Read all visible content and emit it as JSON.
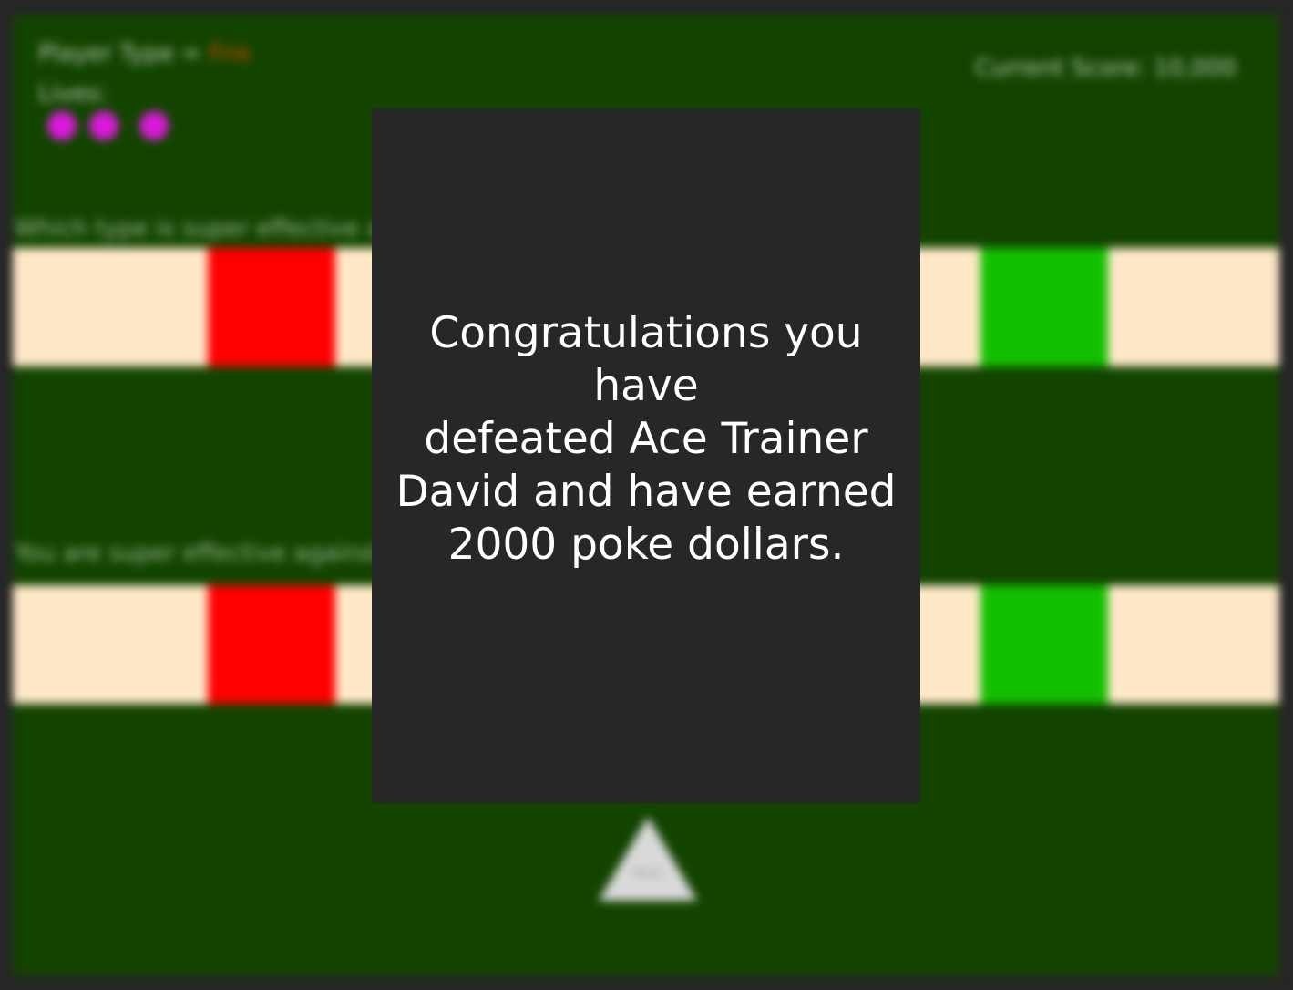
{
  "hud": {
    "player_type_label": "Player Type = ",
    "player_type_value": "Fire",
    "lives_label": "Lives:",
    "lives_count": 3,
    "score_text": "Current Score: 10,000"
  },
  "questions": [
    {
      "prompt": "Which type is super effective against...",
      "answers": [
        "",
        "",
        "",
        ""
      ]
    },
    {
      "prompt": "You are super effective against wh...",
      "answers": [
        "",
        "",
        "",
        ""
      ]
    }
  ],
  "next_button": {
    "label": "Next"
  },
  "modal": {
    "message": "Congratulations you have\ndefeated Ace Trainer \nDavid and have earned\n2000 poke dollars."
  },
  "colors": {
    "board": "#124400",
    "answer_bg": "#ffe8c8",
    "wrong": "#ff0000",
    "correct": "#13c000",
    "modal_bg": "#272727",
    "life": "#d81ad8"
  }
}
